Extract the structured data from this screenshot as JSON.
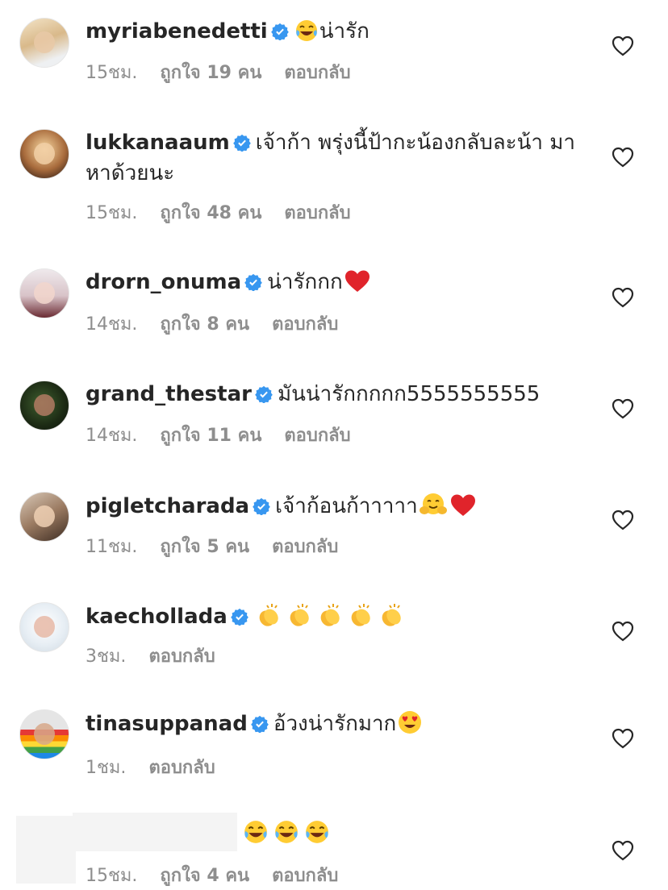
{
  "comments": [
    {
      "username": "myriabenedetti",
      "text": "น่ารัก",
      "emoji_before": [
        "tears-of-joy"
      ],
      "emoji_after": [],
      "time": "15ชม.",
      "likes": "ถูกใจ 19 คน",
      "reply": "ตอบกลับ"
    },
    {
      "username": "lukkanaaum",
      "text": "เจ้าก้า พรุ่งนี้ป้ากะน้องกลับละน้า มาหาด้วยนะ",
      "emoji_before": [],
      "emoji_after": [],
      "time": "15ชม.",
      "likes": "ถูกใจ 48 คน",
      "reply": "ตอบกลับ"
    },
    {
      "username": "drorn_onuma",
      "text": "น่ารักกก",
      "emoji_before": [],
      "emoji_after": [
        "red-heart"
      ],
      "time": "14ชม.",
      "likes": "ถูกใจ 8 คน",
      "reply": "ตอบกลับ"
    },
    {
      "username": "grand_thestar",
      "text": "มันน่ารักกกกก5555555555",
      "emoji_before": [],
      "emoji_after": [],
      "time": "14ชม.",
      "likes": "ถูกใจ 11 คน",
      "reply": "ตอบกลับ"
    },
    {
      "username": "pigletcharada",
      "text": "เจ้าก้อนก้าาาาา",
      "emoji_before": [],
      "emoji_after": [
        "hugging-face",
        "red-heart"
      ],
      "time": "11ชม.",
      "likes": "ถูกใจ 5 คน",
      "reply": "ตอบกลับ"
    },
    {
      "username": "kaechollada",
      "text": "",
      "emoji_before": [],
      "emoji_after": [
        "clapping-hands",
        "clapping-hands",
        "clapping-hands",
        "clapping-hands",
        "clapping-hands"
      ],
      "time": "3ชม.",
      "likes": "",
      "reply": "ตอบกลับ"
    },
    {
      "username": "tinasuppanad",
      "text": "อ้วงน่ารักมาก",
      "emoji_before": [],
      "emoji_after": [
        "heart-eyes"
      ],
      "time": "1ชม.",
      "likes": "",
      "reply": "ตอบกลับ"
    },
    {
      "username": "",
      "text": "",
      "emoji_before": [],
      "emoji_after": [
        "tears-of-joy",
        "tears-of-joy",
        "tears-of-joy"
      ],
      "time": "15ชม.",
      "likes": "ถูกใจ 4 คน",
      "reply": "ตอบกลับ"
    }
  ],
  "icons": {
    "verified": "verified-badge-icon",
    "like": "heart-outline-icon"
  },
  "colors": {
    "verified": "#3897f0",
    "muted": "#8e8e8e",
    "text": "#262626"
  }
}
